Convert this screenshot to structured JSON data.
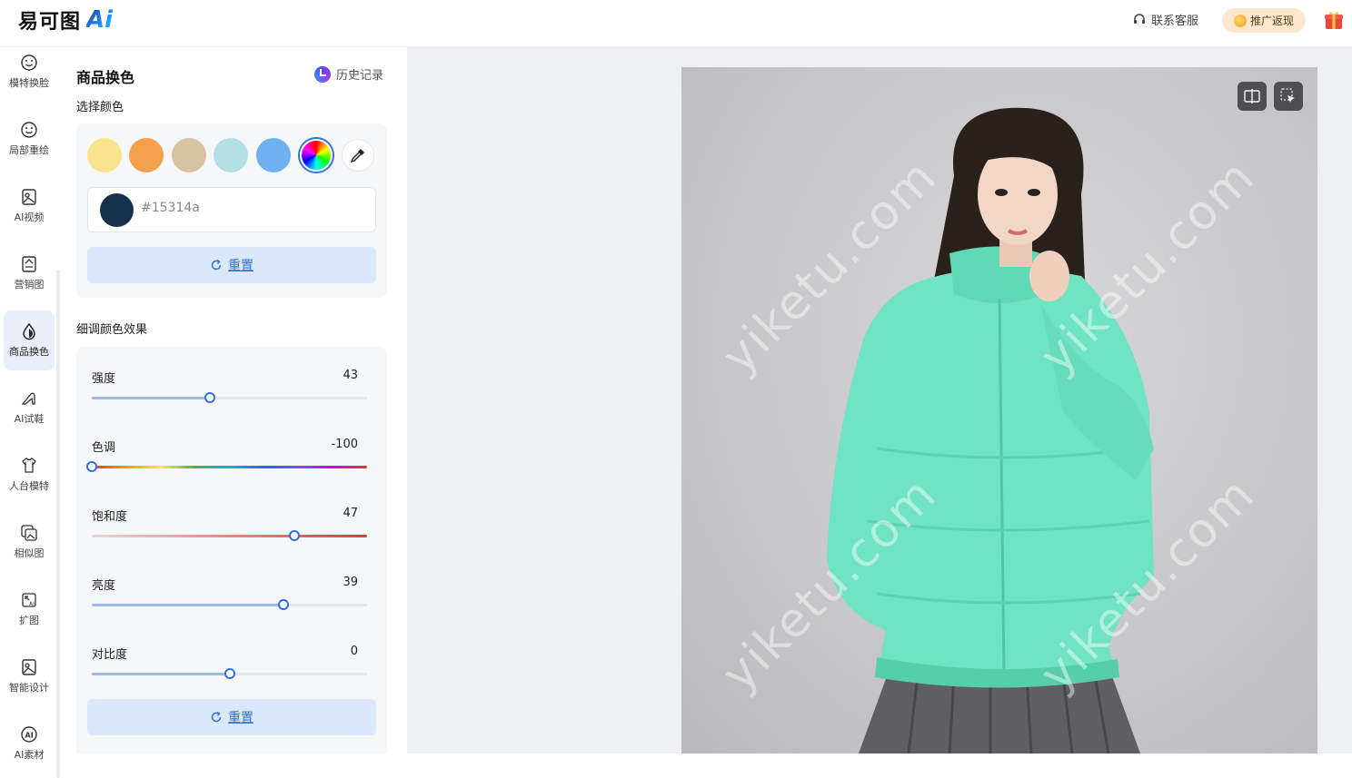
{
  "header": {
    "logo_text": "易可图",
    "logo_ai": "Ai",
    "support_label": "联系客服",
    "promo_label": "推广返现"
  },
  "sidebar": {
    "items": [
      {
        "label": "模特换脸",
        "icon": "face-smile-icon"
      },
      {
        "label": "局部重绘",
        "icon": "face-smile-icon"
      },
      {
        "label": "AI视频",
        "icon": "video-icon"
      },
      {
        "label": "营销图",
        "icon": "marketing-image-icon"
      },
      {
        "label": "商品换色",
        "icon": "color-drop-icon",
        "active": true
      },
      {
        "label": "AI试鞋",
        "icon": "high-heel-icon"
      },
      {
        "label": "人台模特",
        "icon": "mannequin-icon"
      },
      {
        "label": "相似图",
        "icon": "similar-image-icon"
      },
      {
        "label": "扩图",
        "icon": "expand-image-icon"
      },
      {
        "label": "智能设计",
        "icon": "smart-design-icon"
      },
      {
        "label": "AI素材",
        "icon": "ai-material-icon"
      }
    ]
  },
  "panel": {
    "title": "商品换色",
    "history_label": "历史记录",
    "select_color_label": "选择颜色",
    "swatches": [
      "#f9e38d",
      "#f5a04f",
      "#d6c4a0",
      "#b3e0e3",
      "#6fb0f0"
    ],
    "hex_value": "#15314a",
    "reset_label": "重置",
    "fine_tune_label": "细调颜色效果",
    "sliders": [
      {
        "label": "强度",
        "value": "43",
        "fraction": 0.43,
        "kind": "normal"
      },
      {
        "label": "色调",
        "value": "-100",
        "fraction": 0.0,
        "kind": "hue"
      },
      {
        "label": "饱和度",
        "value": "47",
        "fraction": 0.735,
        "kind": "sat"
      },
      {
        "label": "亮度",
        "value": "39",
        "fraction": 0.695,
        "kind": "normal"
      },
      {
        "label": "对比度",
        "value": "0",
        "fraction": 0.5,
        "kind": "normal"
      }
    ],
    "reset2_label": "重置"
  },
  "canvas": {
    "watermark": "yiketu.com",
    "compare_icon": "compare-icon",
    "select_icon": "select-cursor-icon"
  }
}
